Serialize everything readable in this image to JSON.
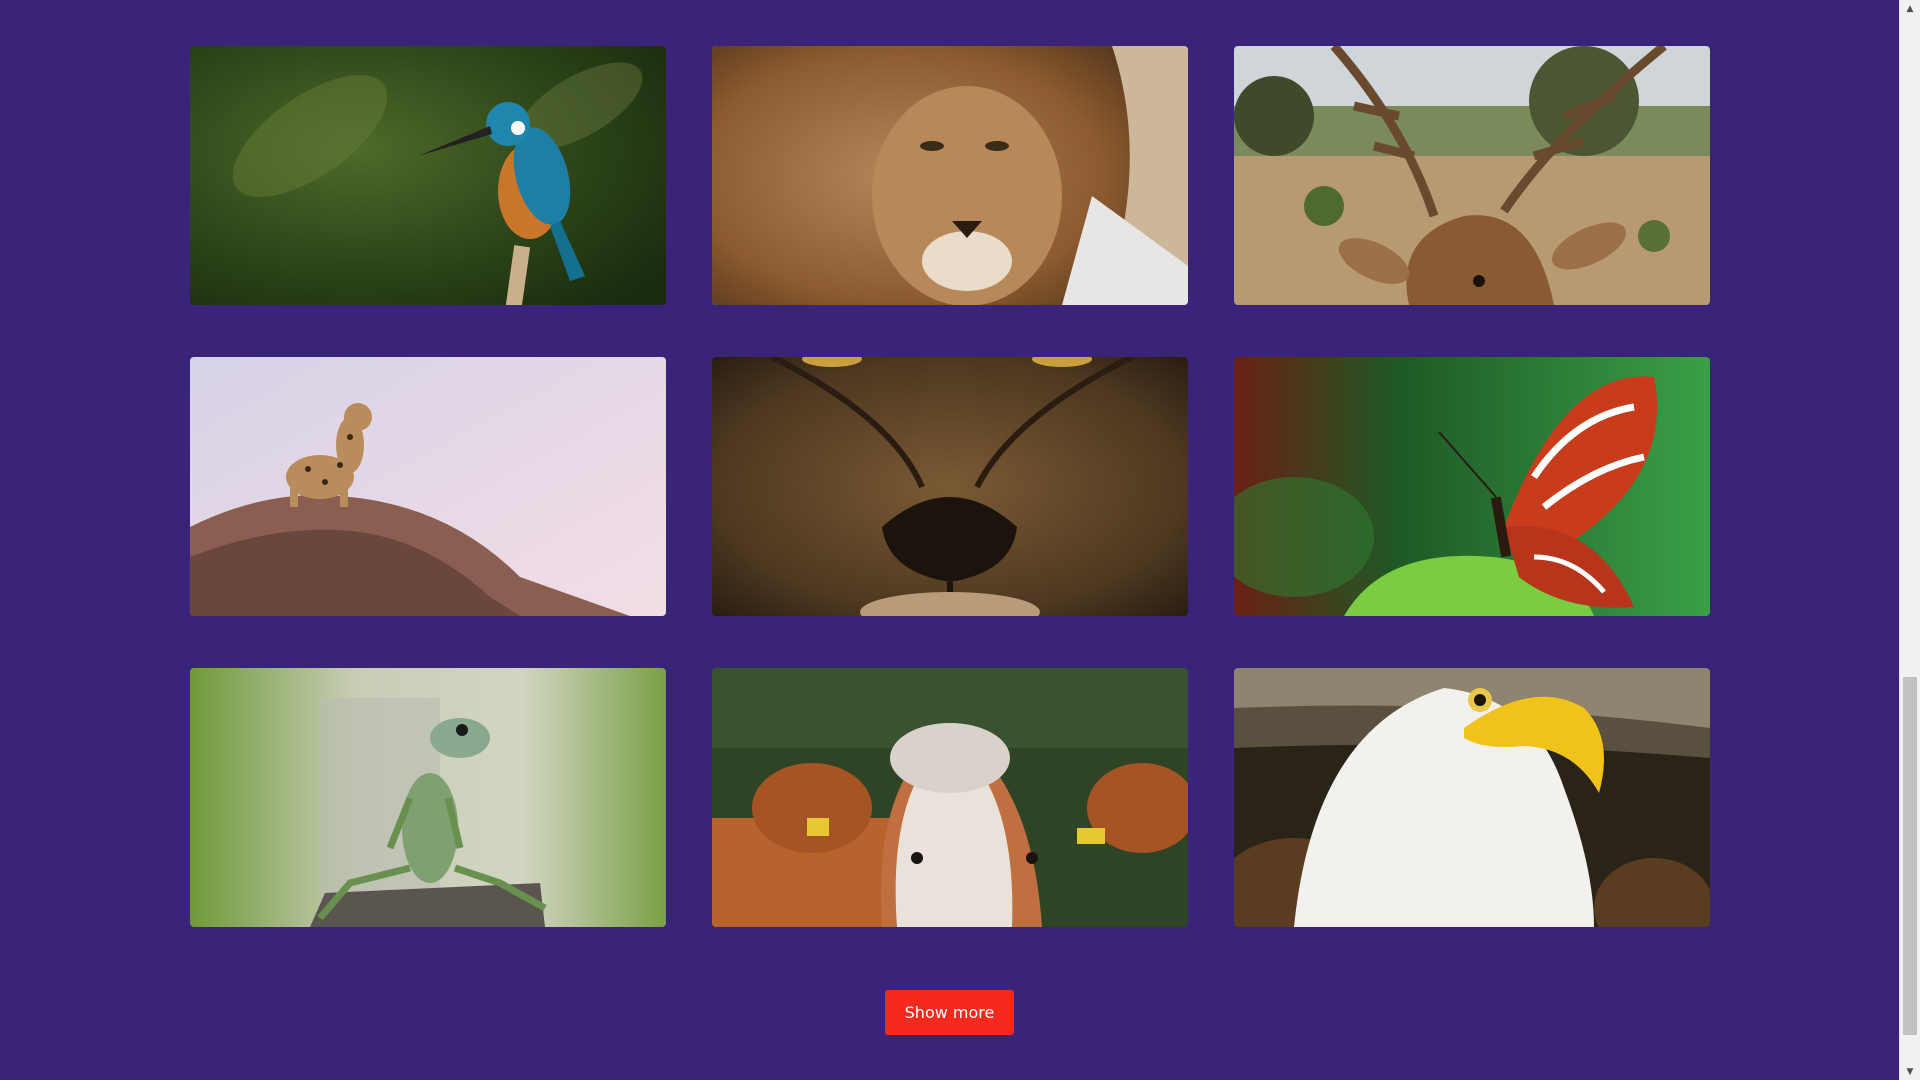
{
  "gallery": {
    "images": [
      {
        "subject": "kingfisher"
      },
      {
        "subject": "lion"
      },
      {
        "subject": "deer"
      },
      {
        "subject": "leopard"
      },
      {
        "subject": "lion-closeup"
      },
      {
        "subject": "butterfly"
      },
      {
        "subject": "lizard"
      },
      {
        "subject": "cow"
      },
      {
        "subject": "bald-eagle"
      }
    ]
  },
  "actions": {
    "show_more_label": "Show more"
  },
  "scrollbar": {
    "up_icon": "scroll-up-arrow",
    "down_icon": "scroll-down-arrow",
    "position_fraction": 0.62
  },
  "colors": {
    "background": "#3a2479",
    "button": "#f5291e",
    "button_text": "#ffffff"
  }
}
